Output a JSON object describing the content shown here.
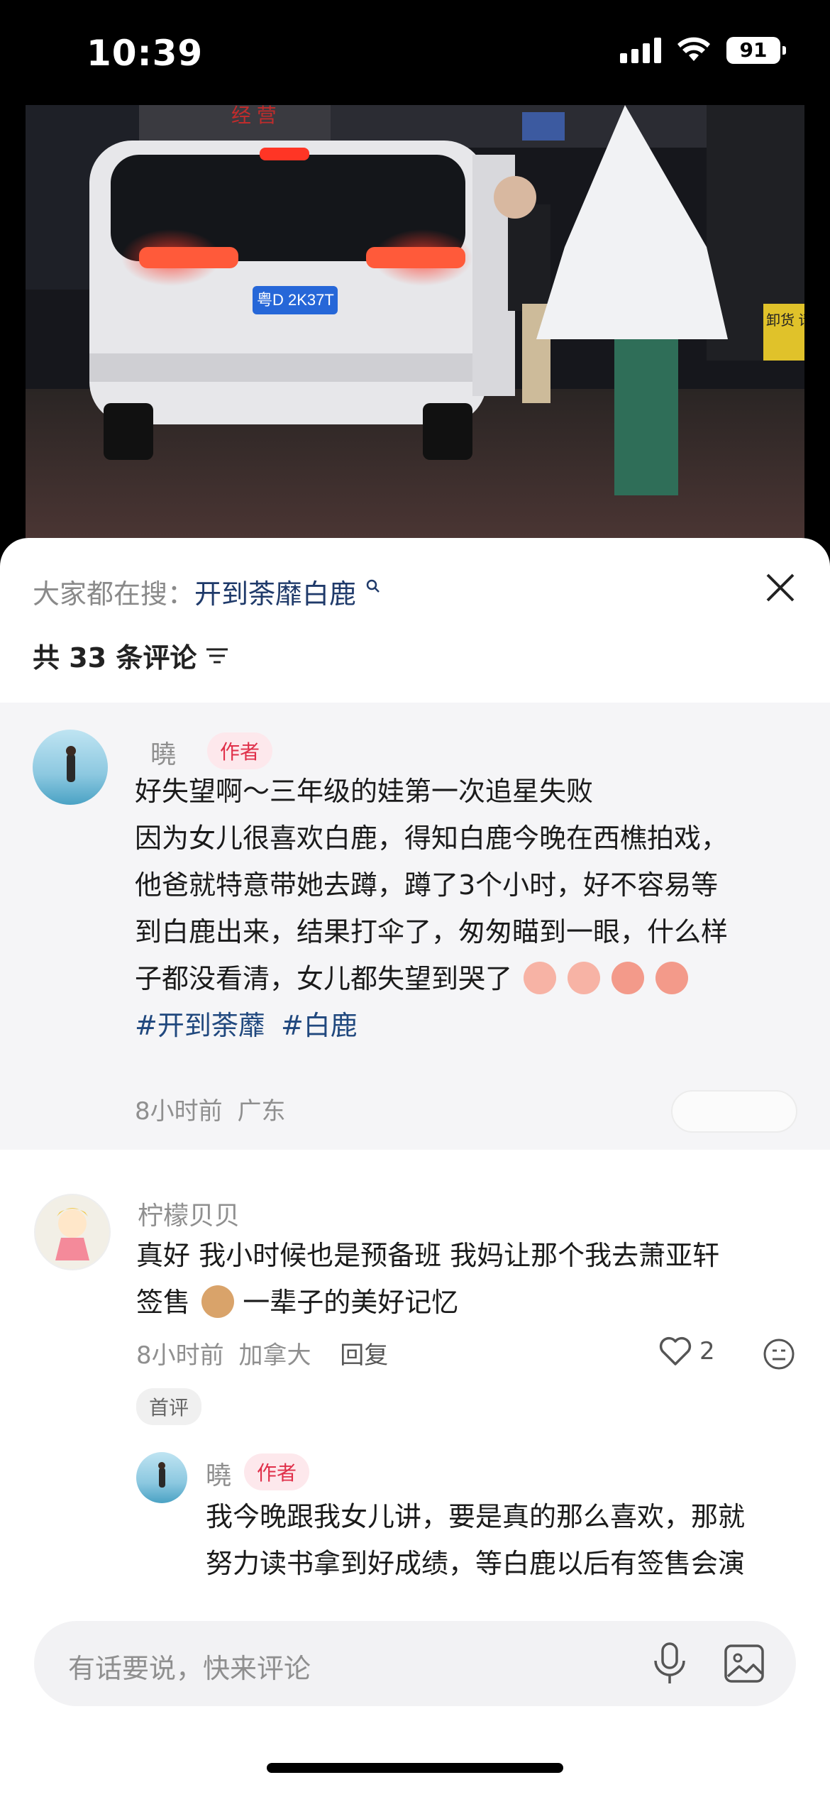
{
  "status_bar": {
    "time": "10:39",
    "battery": "91"
  },
  "video": {
    "sign_text": "经 营",
    "plate": "粤D 2K37T",
    "side_sign": "卸货 请勿"
  },
  "comments_sheet": {
    "search_prefix": "大家都在搜：",
    "search_keyword": "开到荼靡白鹿",
    "count_label": "共 33 条评论"
  },
  "author_comment": {
    "name": "曉",
    "badge": "作者",
    "lines": [
      "好失望啊～三年级的娃第一次追星失败",
      "因为女儿很喜欢白鹿，得知白鹿今晚在西樵拍戏，",
      "他爸就特意带她去蹲，蹲了3个小时，好不容易等",
      "到白鹿出来，结果打伞了，匆匆瞄到一眼，什么样",
      "子都没看清，女儿都失望到哭了"
    ],
    "tags": [
      "#开到荼蘼",
      "#白鹿"
    ],
    "time": "8小时前",
    "location": "广东"
  },
  "comment_1": {
    "name": "柠檬贝贝",
    "line1": "真好 我小时候也是预备班 我妈让那个我去萧亚轩",
    "line2_a": "签售",
    "line2_b": "一辈子的美好记忆",
    "time": "8小时前",
    "location": "加拿大",
    "reply_label": "回复",
    "likes": "2",
    "first_tag": "首评"
  },
  "reply_1": {
    "name": "曉",
    "badge": "作者",
    "line1": "我今晚跟我女儿讲，要是真的那么喜欢，那就",
    "line2": "努力读书拿到好成绩，等白鹿以后有签售会演"
  },
  "input": {
    "placeholder": "有话要说，快来评论"
  }
}
